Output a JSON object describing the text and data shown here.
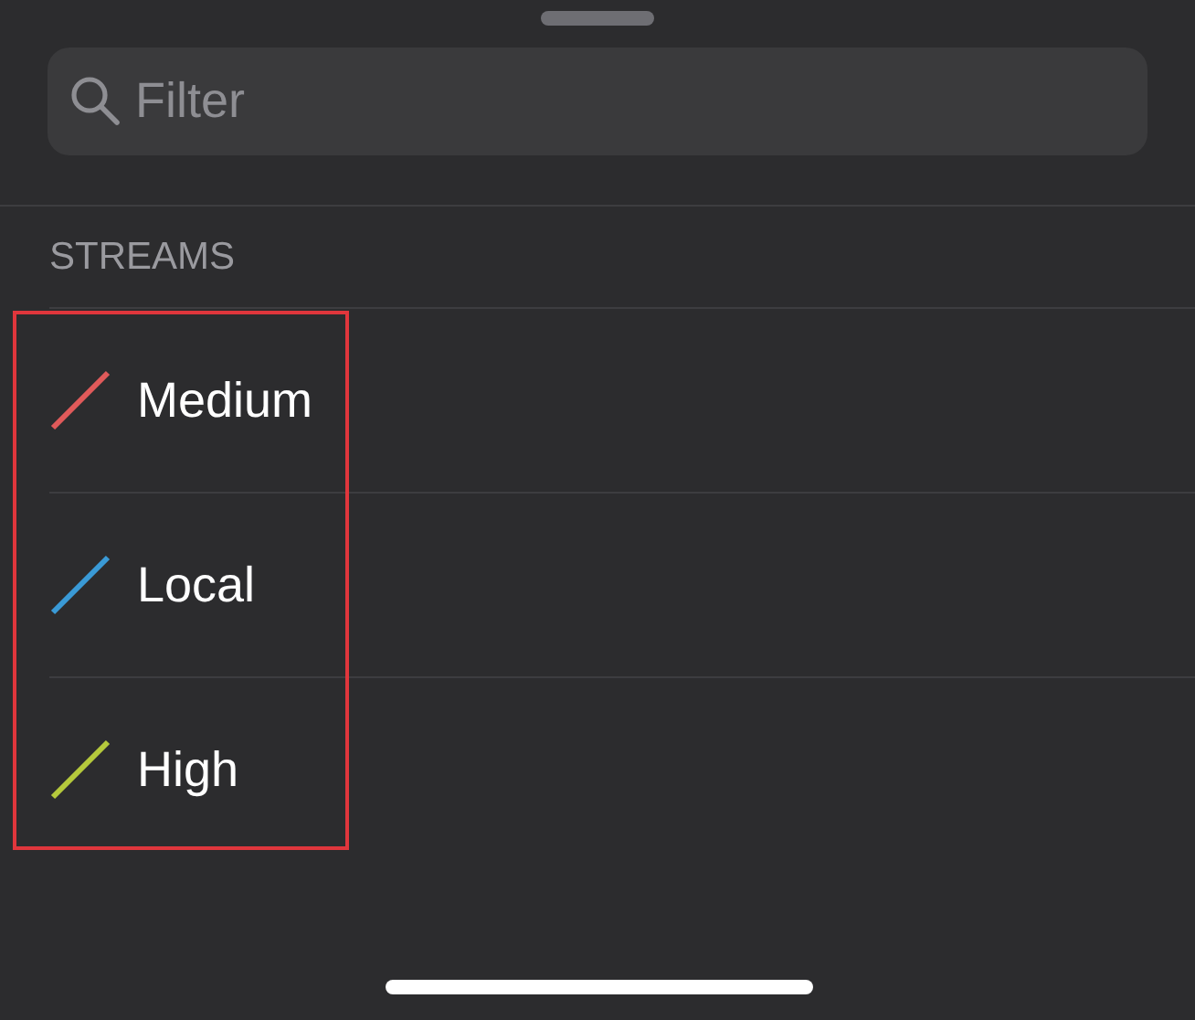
{
  "search": {
    "placeholder": "Filter"
  },
  "section": {
    "title": "STREAMS"
  },
  "streams": [
    {
      "name": "Medium",
      "color": "#e05a5a"
    },
    {
      "name": "Local",
      "color": "#3a9ad6"
    },
    {
      "name": "High",
      "color": "#b5c93c"
    }
  ]
}
